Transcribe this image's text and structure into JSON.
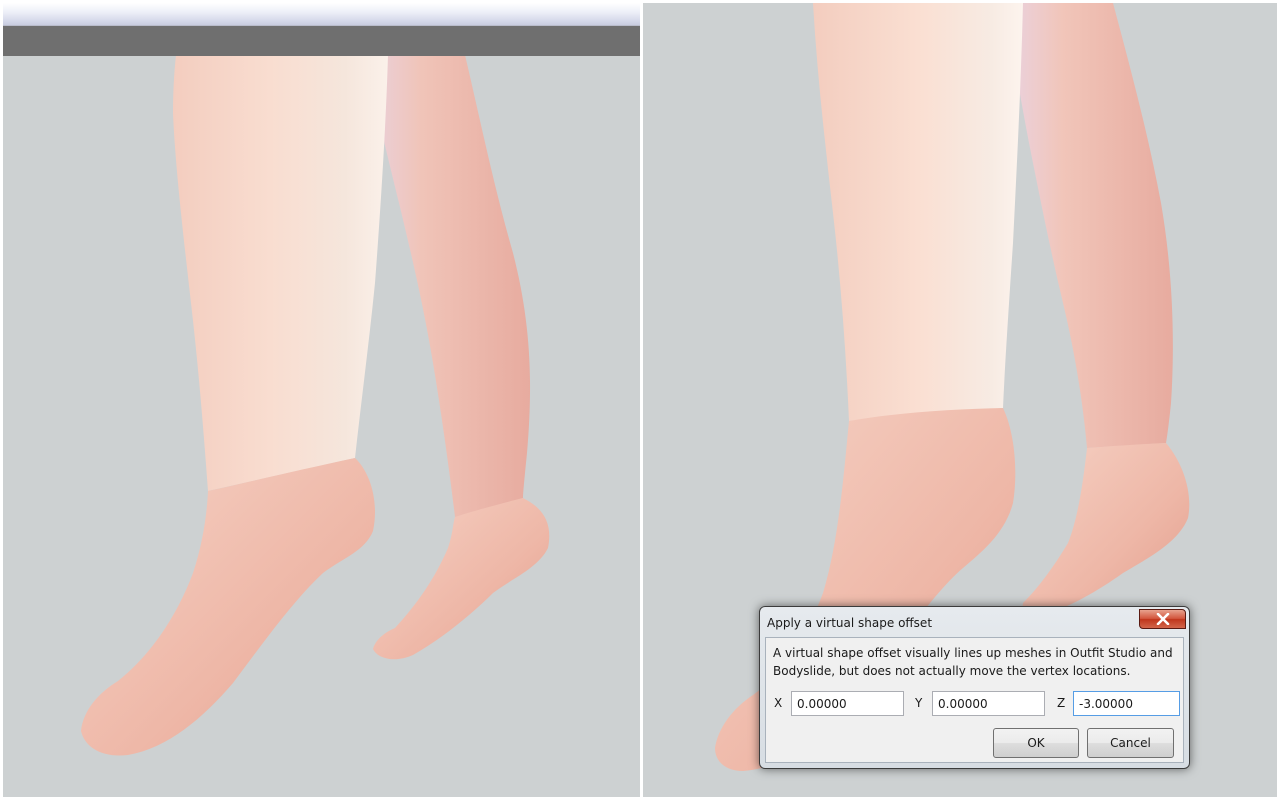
{
  "dialog": {
    "title": "Apply a virtual shape offset",
    "close_icon": "close-icon",
    "message_line1": "A virtual shape offset visually lines up meshes in Outfit Studio and",
    "message_line2": "Bodyslide, but does not actually move the vertex locations.",
    "x_label": "X",
    "y_label": "Y",
    "z_label": "Z",
    "x_value": "0.00000",
    "y_value": "0.00000",
    "z_value": "-3.00000",
    "ok_label": "OK",
    "cancel_label": "Cancel"
  },
  "colors": {
    "viewport_background": "#cdd1d2",
    "skin": "#f2c6b8",
    "close_button": "#c9422a"
  }
}
